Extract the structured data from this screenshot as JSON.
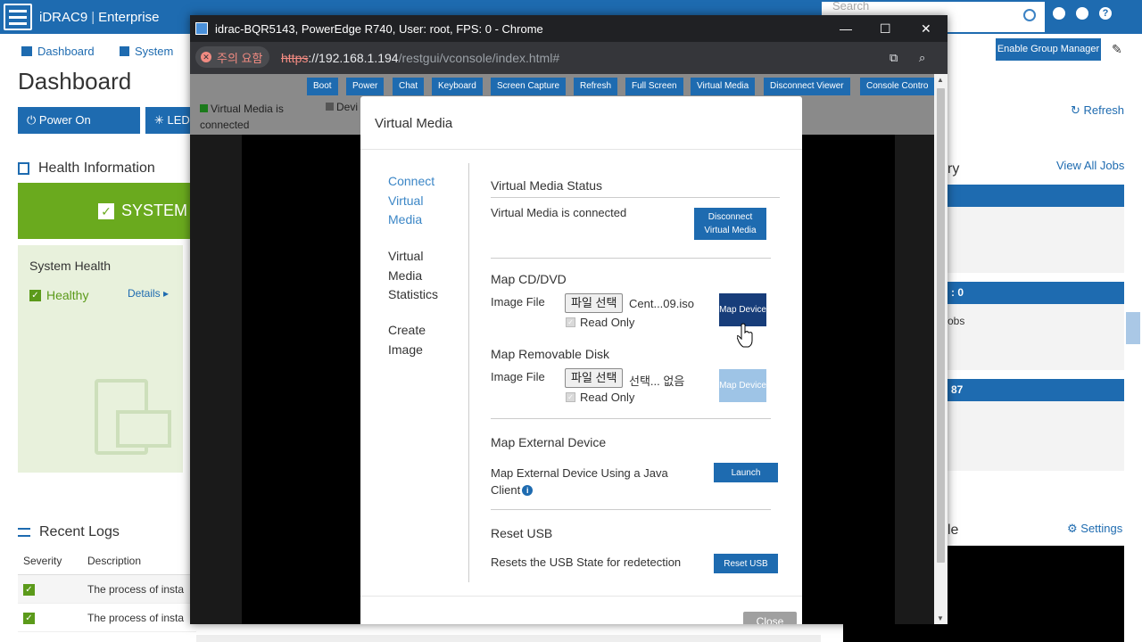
{
  "idrac": {
    "brand": "iDRAC9",
    "edition": "Enterprise",
    "search_placeholder": "Search",
    "nav": {
      "dashboard": "Dashboard",
      "system": "System"
    },
    "group_manager_btn": "Enable Group Manager",
    "page_title": "Dashboard",
    "power_btn": "Power On System",
    "led_btn": "LED",
    "health_title": "Health Information",
    "system_label": "SYSTEM",
    "system_health": "System Health",
    "healthy": "Healthy",
    "details": "Details",
    "refresh": "Refresh",
    "view_all_jobs": "View All Jobs",
    "ry_fragment": "ry",
    "count_fragment": ": 0",
    "jobs_fragment": "obs",
    "num_fragment": "87",
    "le_fragment": "le",
    "settings": "Settings",
    "recent_logs": "Recent Logs",
    "logs_headers": [
      "Severity",
      "Description"
    ],
    "logs_rows": [
      "The process of insta",
      "The process of insta"
    ]
  },
  "chrome": {
    "window_title": "idrac-BQR5143, PowerEdge R740, User: root, FPS: 0 - Chrome",
    "warning": "주의 요함",
    "url_https": "https",
    "url_host": "://192.168.1.194",
    "url_path": "/restgui/vconsole/index.html#"
  },
  "viewer": {
    "toolbar": [
      "Boot",
      "Power",
      "Chat",
      "Keyboard",
      "Screen Capture",
      "Refresh",
      "Full Screen",
      "Virtual Media",
      "Disconnect Viewer",
      "Console Contro"
    ],
    "vm_status": "Virtual Media is connected",
    "device_status": "Devi"
  },
  "modal": {
    "title": "Virtual Media",
    "nav": [
      "Connect Virtual Media",
      "Virtual Media Statistics",
      "Create Image"
    ],
    "status_title": "Virtual Media Status",
    "status_text": "Virtual Media is connected",
    "disconnect_btn": "Disconnect Virtual Media",
    "cd_title": "Map CD/DVD",
    "image_file": "Image File",
    "choose_file": "파일 선택",
    "cd_file": "Cent...09.iso",
    "read_only": "Read Only",
    "map_device": "Map Device",
    "disk_title": "Map Removable Disk",
    "disk_file": "선택... 없음",
    "ext_title": "Map External Device",
    "ext_text_1": "Map External Device Using a Java",
    "ext_text_2": "Client",
    "launch": "Launch",
    "reset_title": "Reset USB",
    "reset_text": "Resets the USB State for redetection",
    "reset_btn": "Reset USB",
    "close": "Close"
  }
}
